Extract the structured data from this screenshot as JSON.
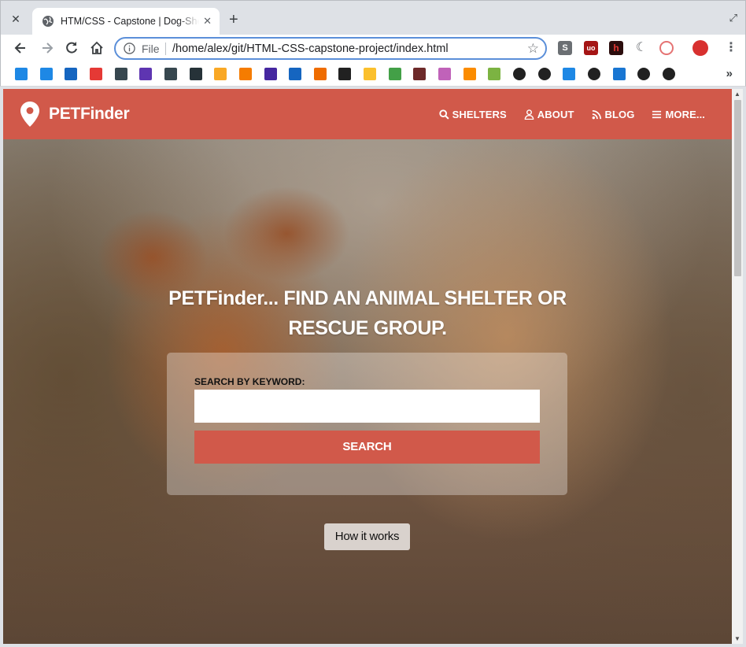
{
  "browser": {
    "tab_title": "HTM/CSS - Capstone | Dog-Shelter",
    "omnibox_scheme": "File",
    "url": "/home/alex/git/HTML-CSS-capstone-project/index.html",
    "icons": {
      "close": "close-icon",
      "new_tab": "plus-icon",
      "maximize": "maximize-icon",
      "back": "back-arrow-icon",
      "forward": "forward-arrow-icon",
      "reload": "reload-icon",
      "home": "home-icon",
      "info": "info-icon",
      "star": "star-icon",
      "menu": "menu-dots-icon"
    },
    "extensions": [
      {
        "name": "s-extension-icon",
        "color": "#5f6368"
      },
      {
        "name": "ublock-icon",
        "color": "#c00000"
      },
      {
        "name": "h-extension-icon",
        "color": "#7a1d1d"
      },
      {
        "name": "c-extension-icon",
        "color": "#5f6368"
      },
      {
        "name": "lastpass-icon",
        "color": "#d93a3a"
      },
      {
        "name": "angry-bird-avatar-icon",
        "color": "#d8302f"
      }
    ],
    "bookmarks": [
      {
        "name": "rss-icon",
        "color": "#1e88e5"
      },
      {
        "name": "podcast-icon",
        "color": "#1e88e5"
      },
      {
        "name": "feed-icon",
        "color": "#1565c0"
      },
      {
        "name": "iliad-icon",
        "color": "#e53935"
      },
      {
        "name": "book-icon",
        "color": "#37474f"
      },
      {
        "name": "zcc-icon",
        "color": "#5e35b1"
      },
      {
        "name": "c-bracket-icon",
        "color": "#37474f"
      },
      {
        "name": "code-icon",
        "color": "#263238"
      },
      {
        "name": "crown-icon",
        "color": "#f9a825"
      },
      {
        "name": "stack-icon",
        "color": "#f57c00"
      },
      {
        "name": "mu-icon",
        "color": "#4527a0"
      },
      {
        "name": "edx-icon",
        "color": "#1565c0"
      },
      {
        "name": "news-icon",
        "color": "#ef6c00"
      },
      {
        "name": "hat-icon",
        "color": "#212121"
      },
      {
        "name": "stripes-icon",
        "color": "#fbc02d"
      },
      {
        "name": "fhd-icon",
        "color": "#43a047"
      },
      {
        "name": "star-box-icon",
        "color": "#6d2a2a"
      },
      {
        "name": "play-pink-icon",
        "color": "#c062b9"
      },
      {
        "name": "s-orange-icon",
        "color": "#fb8c00"
      },
      {
        "name": "play-green-icon",
        "color": "#7cb342"
      },
      {
        "name": "globe-icon-1",
        "color": "#212121"
      },
      {
        "name": "globe-icon-2",
        "color": "#212121"
      },
      {
        "name": "bitwarden-icon",
        "color": "#1e88e5"
      },
      {
        "name": "globe-icon-3",
        "color": "#212121"
      },
      {
        "name": "vuetify-icon",
        "color": "#1976d2"
      },
      {
        "name": "globe-icon-4",
        "color": "#212121"
      },
      {
        "name": "globe-icon-5",
        "color": "#212121"
      }
    ],
    "bookmarks_overflow": "»"
  },
  "site": {
    "brand": "PETFinder",
    "brand_color": "#d1594a",
    "nav": [
      {
        "label": "SHELTERS",
        "icon": "search-icon"
      },
      {
        "label": "ABOUT",
        "icon": "user-icon"
      },
      {
        "label": "BLOG",
        "icon": "rss-icon"
      },
      {
        "label": "MORE...",
        "icon": "hamburger-icon"
      }
    ],
    "hero": {
      "title_line1": "PETFinder... FIND AN ANIMAL SHELTER OR",
      "title_line2": "RESCUE GROUP.",
      "search_label": "SEARCH BY KEYWORD:",
      "search_value": "",
      "search_button": "SEARCH",
      "how_button": "How it works"
    }
  }
}
